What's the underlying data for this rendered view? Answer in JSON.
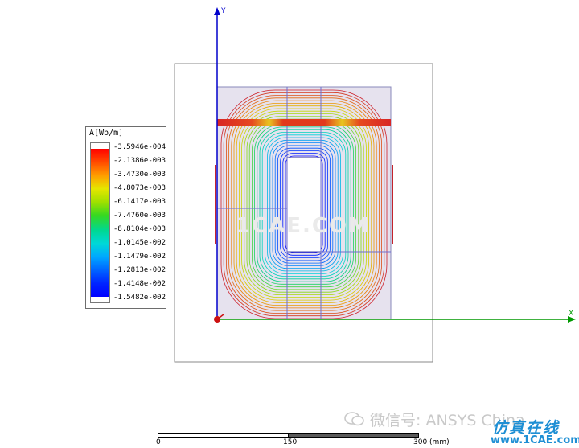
{
  "axes": {
    "y_label": "Y",
    "x_label": "X"
  },
  "legend": {
    "title": "A[Wb/m]",
    "labels": [
      "-3.5946e-004",
      "-2.1386e-003",
      "-3.4730e-003",
      "-4.8073e-003",
      "-6.1417e-003",
      "-7.4760e-003",
      "-8.8104e-003",
      "-1.0145e-002",
      "-1.1479e-002",
      "-1.2813e-002",
      "-1.4148e-002",
      "-1.5482e-002"
    ]
  },
  "scale": {
    "label_0": "0",
    "label_150": "150",
    "label_300": "300 (mm)"
  },
  "watermarks": {
    "wechat": "微信号: ANSYS China",
    "center": "1CAE.COM",
    "site_zh": "仿真在线",
    "site_url": "www.1CAE.com"
  },
  "colors": {
    "field_line": "#c4242c",
    "geometry": "#5b5bd6",
    "axis": "#0000cc",
    "scale_bar_dark": "#5a5a5a"
  }
}
